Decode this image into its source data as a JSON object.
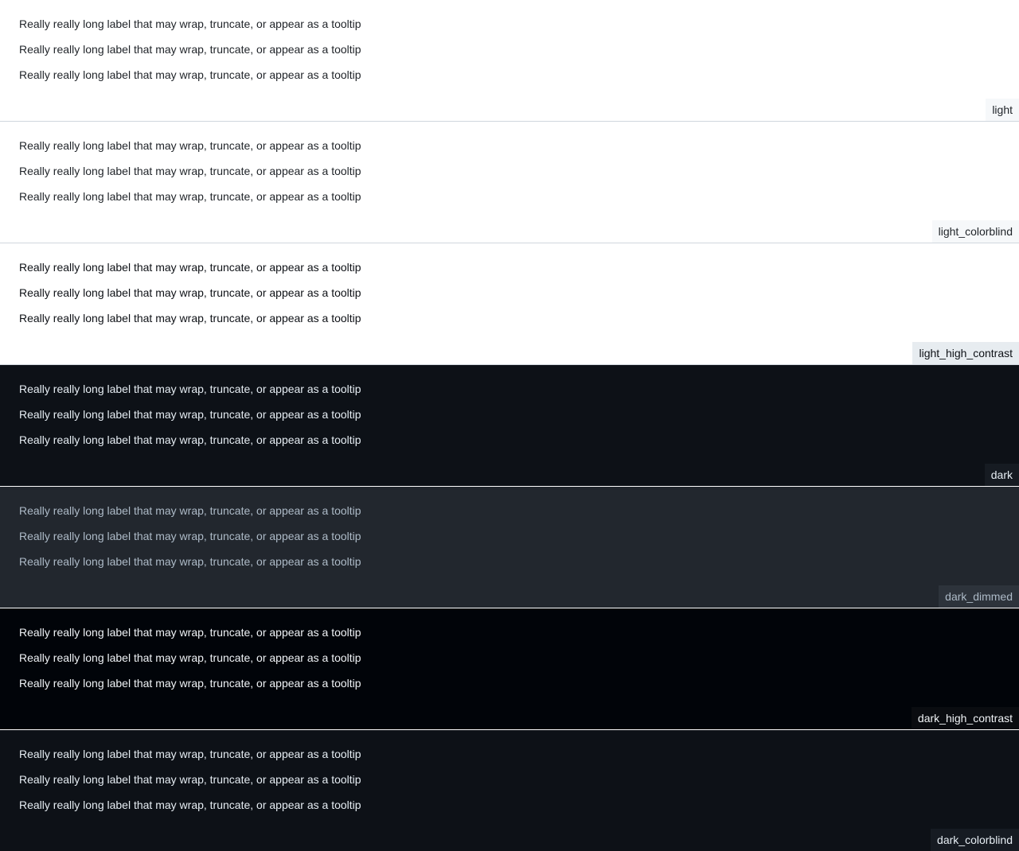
{
  "item_label": "Really really long label that may wrap, truncate, or appear as a tooltip",
  "themes": [
    {
      "name": "light",
      "bg": "#ffffff",
      "fg": "#1f2328",
      "tag_bg": "#f6f8fa",
      "tag_fg": "#1f2328"
    },
    {
      "name": "light_colorblind",
      "bg": "#ffffff",
      "fg": "#1f2328",
      "tag_bg": "#f6f8fa",
      "tag_fg": "#1f2328"
    },
    {
      "name": "light_high_contrast",
      "bg": "#ffffff",
      "fg": "#0e1116",
      "tag_bg": "#e7ecf0",
      "tag_fg": "#0e1116"
    },
    {
      "name": "dark",
      "bg": "#0d1117",
      "fg": "#e6edf3",
      "tag_bg": "#161b22",
      "tag_fg": "#e6edf3"
    },
    {
      "name": "dark_dimmed",
      "bg": "#22272e",
      "fg": "#adbac7",
      "tag_bg": "#2d333b",
      "tag_fg": "#adbac7"
    },
    {
      "name": "dark_high_contrast",
      "bg": "#010409",
      "fg": "#f0f3f6",
      "tag_bg": "#0a0c10",
      "tag_fg": "#f0f3f6"
    },
    {
      "name": "dark_colorblind",
      "bg": "#0d1117",
      "fg": "#e6edf3",
      "tag_bg": "#161b22",
      "tag_fg": "#e6edf3"
    }
  ]
}
